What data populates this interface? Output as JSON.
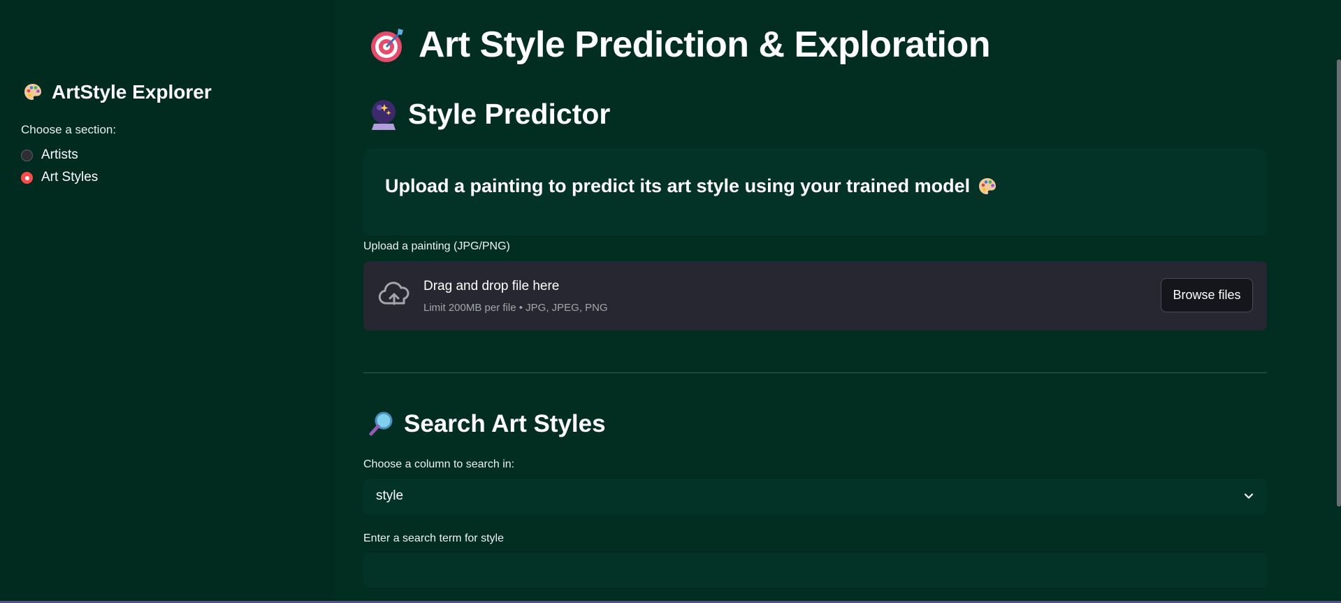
{
  "sidebar": {
    "title": "ArtStyle Explorer",
    "section_label": "Choose a section:",
    "options": [
      {
        "label": "Artists",
        "selected": false
      },
      {
        "label": "Art Styles",
        "selected": true
      }
    ]
  },
  "main": {
    "page_title": "Art Style Prediction & Exploration",
    "predictor": {
      "heading": "Style Predictor",
      "info": "Upload a painting to predict its art style using your trained model",
      "upload_label": "Upload a painting (JPG/PNG)",
      "dropzone_text": "Drag and drop file here",
      "dropzone_limit": "Limit 200MB per file • JPG, JPEG, PNG",
      "browse_label": "Browse files"
    },
    "search": {
      "heading": "Search Art Styles",
      "column_label": "Choose a column to search in:",
      "column_value": "style",
      "term_label": "Enter a search term for style",
      "term_value": ""
    }
  },
  "icons": {
    "title_icon": "target-icon",
    "sidebar_icon": "palette-icon",
    "predictor_icon": "crystal-ball-icon",
    "search_icon": "magnifying-glass-icon"
  },
  "colors": {
    "background": "#022e22",
    "panel": "#033326",
    "accent": "#ff4b4b",
    "uploader": "#262730"
  }
}
